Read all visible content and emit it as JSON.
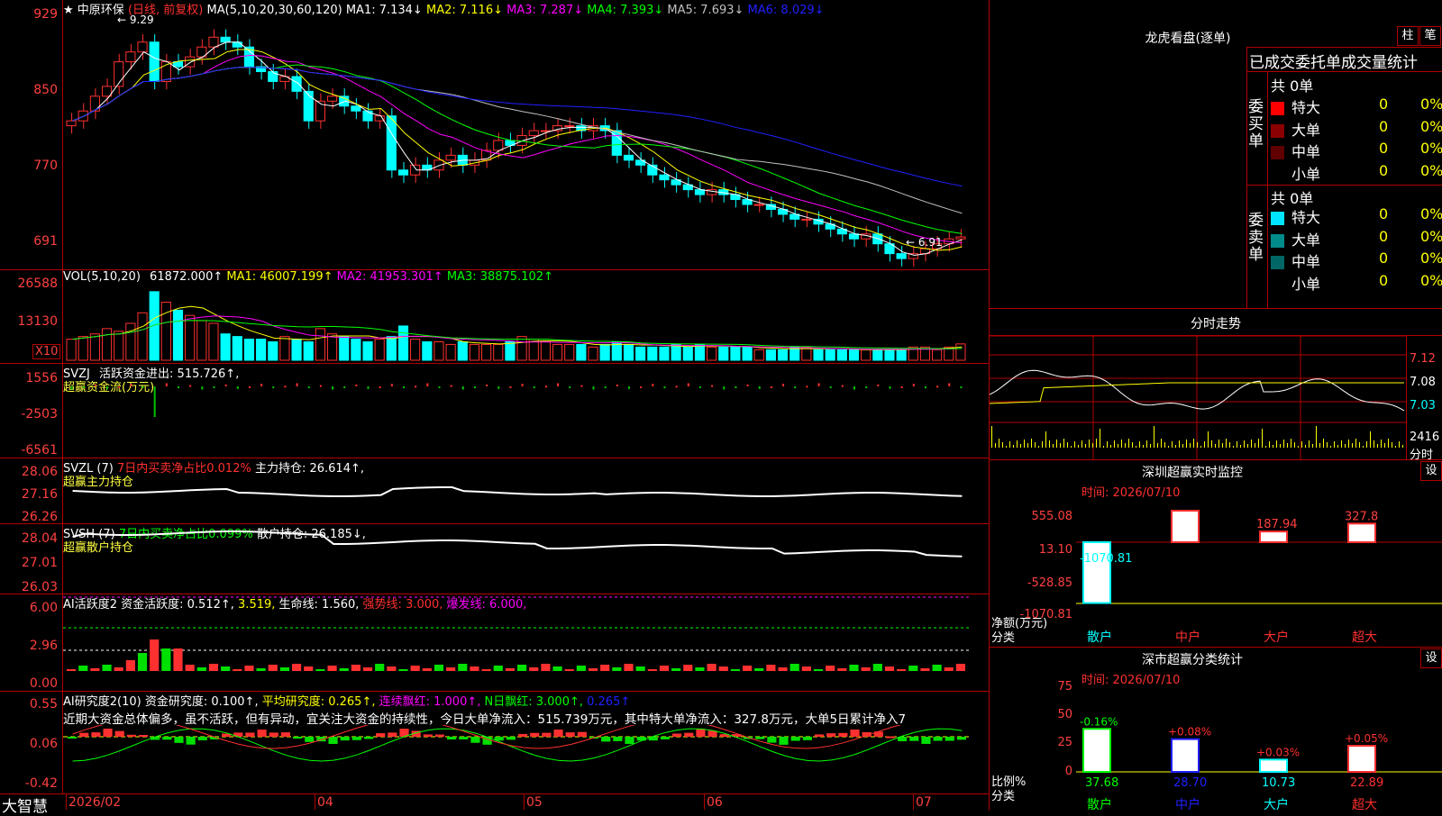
{
  "header": {
    "star": "★",
    "stock_name": "中原环保",
    "period": "(日线, 前复权)",
    "ma_params": "MA(5,10,20,30,60,120)",
    "ma": [
      {
        "label": "MA1: 7.134↓",
        "color": "#ffffff"
      },
      {
        "label": "MA2: 7.116↓",
        "color": "#ffff00"
      },
      {
        "label": "MA3: 7.287↓",
        "color": "#ff00ff"
      },
      {
        "label": "MA4: 7.393↓",
        "color": "#00ff00"
      },
      {
        "label": "MA5: 7.693↓",
        "color": "#c0c0c0"
      },
      {
        "label": "MA6: 8.029↓",
        "color": "#2020ff"
      }
    ],
    "high_marker": "9.29",
    "low_marker": "6.91"
  },
  "price_axis": [
    "929",
    "850",
    "770",
    "691"
  ],
  "vol_axis": [
    "26588",
    "13130",
    "X10"
  ],
  "zj_axis": [
    "1556",
    "-2503",
    "-6561"
  ],
  "zl_axis": [
    "28.06",
    "27.16",
    "26.26"
  ],
  "sh_axis": [
    "28.04",
    "27.01",
    "26.03"
  ],
  "ai1_axis": [
    "6.00",
    "2.96",
    "0.00"
  ],
  "ai2_axis": [
    "0.55",
    "0.06",
    "-0.42"
  ],
  "vol": {
    "params": "VOL(5,10,20)",
    "value": "61872.000↑",
    "ma": [
      {
        "label": "MA1: 46007.199↑",
        "color": "#ffff00"
      },
      {
        "label": "MA2: 41953.301↑",
        "color": "#ff00ff"
      },
      {
        "label": "MA3: 38875.102↑",
        "color": "#00ff00"
      }
    ]
  },
  "svzj": {
    "name": "SVZJ",
    "label": "活跃资金进出: 515.726↑,",
    "sub": "超赢资金流(万元)"
  },
  "svzl": {
    "name": "SVZL (7)",
    "pct": "7日内买卖净占比0.012%",
    "label": "主力持仓: 26.614↑,",
    "sub": "超赢主力持仓"
  },
  "svsh": {
    "name": "SVSH (7)",
    "pct": "7日内买卖净占比0.099%",
    "label": "散户持仓: 26.185↓,",
    "sub": "超赢散户持仓"
  },
  "ai1": {
    "name": "AI活跃度2",
    "items": [
      {
        "t": "资金活跃度: 0.512↑,",
        "c": "#ffffff"
      },
      {
        "t": "3.519,",
        "c": "#ffff00"
      },
      {
        "t": "生命线: 1.560,",
        "c": "#ffffff"
      },
      {
        "t": "强势线: 3.000,",
        "c": "#ff3030"
      },
      {
        "t": "爆发线: 6.000,",
        "c": "#ff00ff"
      }
    ]
  },
  "ai2": {
    "name": "AI研究度2(10)",
    "items": [
      {
        "t": "资金研究度: 0.100↑,",
        "c": "#ffffff"
      },
      {
        "t": "平均研究度: 0.265↑,",
        "c": "#ffff00"
      },
      {
        "t": "连续飘红: 1.000↑,",
        "c": "#ff00ff"
      },
      {
        "t": "N日飘红: 3.000↑,",
        "c": "#00ff00"
      },
      {
        "t": "0.265↑",
        "c": "#2020ff"
      }
    ]
  },
  "commentary": "近期大资金总体偏多，虽不活跃，但有异动，宜关注大资金的持续性，今日大单净流入：515.739万元，其中特大单净流入：327.8万元，大单5日累计净入7",
  "x_axis": [
    {
      "t": "2026/02",
      "x": 76
    },
    {
      "t": "04",
      "x": 352
    },
    {
      "t": "05",
      "x": 584
    },
    {
      "t": "06",
      "x": 784
    },
    {
      "t": "07",
      "x": 1016
    }
  ],
  "footer_brand": "大智慧",
  "right": {
    "lhb_title": "龙虎看盘(逐单)",
    "btn_zhu": "柱",
    "btn_bi": "笔",
    "orders_title": "已成交委托单成交量统计",
    "buy": {
      "label": "委买单",
      "total": "共 0单",
      "rows": [
        {
          "name": "特大",
          "count": "0",
          "pct": "0%",
          "color": "#ff0000"
        },
        {
          "name": "大单",
          "count": "0",
          "pct": "0%",
          "color": "#8b0000"
        },
        {
          "name": "中单",
          "count": "0",
          "pct": "0%",
          "color": "#600000"
        },
        {
          "name": "小单",
          "count": "0",
          "pct": "0%",
          "color": ""
        }
      ]
    },
    "sell": {
      "label": "委卖单",
      "total": "共 0单",
      "rows": [
        {
          "name": "特大",
          "count": "0",
          "pct": "0%",
          "color": "#00e5ff"
        },
        {
          "name": "大单",
          "count": "0",
          "pct": "0%",
          "color": "#008b8b"
        },
        {
          "name": "中单",
          "count": "0",
          "pct": "0%",
          "color": "#006666"
        },
        {
          "name": "小单",
          "count": "0",
          "pct": "0%",
          "color": ""
        }
      ]
    },
    "intraday": {
      "title": "分时走势",
      "price_labels": [
        "7.12",
        "7.08",
        "7.03"
      ],
      "vol_label": "2416",
      "vol_unit": "分时"
    },
    "monitor": {
      "title": "深圳超赢实时监控",
      "btn": "设",
      "time": "时间: 2026/07/10",
      "axis": [
        "555.08",
        "13.10",
        "-528.85",
        "-1070.81"
      ],
      "unit_label": "净额(万元)",
      "cat_label": "分类",
      "bars": [
        {
          "cat": "散户",
          "value": -1070.81,
          "label": "-1070.81"
        },
        {
          "cat": "中户",
          "value": 555.08,
          "label": "555.08"
        },
        {
          "cat": "大户",
          "value": 187.94,
          "label": "187.94"
        },
        {
          "cat": "超大",
          "value": 327.8,
          "label": "327.8"
        }
      ]
    },
    "classify": {
      "title": "深市超赢分类统计",
      "btn": "设",
      "time": "时间: 2026/07/10",
      "axis": [
        "75",
        "50",
        "25",
        "0"
      ],
      "unit_label": "比例%",
      "cat_label": "分类",
      "bars": [
        {
          "cat": "散户",
          "value": 37.68,
          "label": "37.68",
          "change": "-0.16%"
        },
        {
          "cat": "中户",
          "value": 28.7,
          "label": "28.70",
          "change": "+0.08%"
        },
        {
          "cat": "大户",
          "value": 10.73,
          "label": "10.73",
          "change": "+0.03%"
        },
        {
          "cat": "超大",
          "value": 22.89,
          "label": "22.89",
          "change": "+0.05%"
        }
      ]
    }
  },
  "chart_data": [
    {
      "type": "candlestick",
      "title": "中原环保 (日线, 前复权)",
      "ylim": [
        6.91,
        9.29
      ],
      "categories": [
        "2026/02",
        "04",
        "05",
        "06",
        "07"
      ],
      "close_series": [
        8.3,
        8.4,
        8.55,
        8.65,
        8.9,
        9.0,
        9.1,
        8.7,
        8.9,
        8.85,
        8.95,
        9.05,
        9.15,
        9.1,
        9.05,
        8.85,
        8.8,
        8.7,
        8.75,
        8.6,
        8.3,
        8.5,
        8.55,
        8.45,
        8.4,
        8.3,
        8.35,
        7.8,
        7.75,
        7.85,
        7.8,
        7.9,
        7.95,
        7.85,
        7.9,
        8.0,
        8.1,
        8.05,
        8.15,
        8.2,
        8.2,
        8.25,
        8.25,
        8.2,
        8.25,
        8.2,
        7.95,
        7.9,
        7.85,
        7.75,
        7.7,
        7.65,
        7.6,
        7.55,
        7.6,
        7.55,
        7.5,
        7.45,
        7.45,
        7.4,
        7.35,
        7.3,
        7.3,
        7.25,
        7.2,
        7.15,
        7.1,
        7.15,
        7.05,
        6.95,
        6.9,
        6.95,
        7.0,
        7.05,
        7.1,
        7.12
      ]
    },
    {
      "type": "bar",
      "title": "VOL(5,10,20)",
      "values": [
        8,
        9,
        10,
        12,
        11,
        14,
        18,
        26,
        22,
        19,
        17,
        15,
        14,
        10,
        9,
        8,
        8,
        7,
        9,
        8,
        7,
        12,
        10,
        9,
        8,
        7,
        8,
        9,
        13,
        8,
        7,
        7,
        6,
        7,
        6,
        6,
        6,
        7,
        9,
        8,
        7,
        6,
        6,
        6,
        5,
        6,
        7,
        6,
        5,
        5,
        5,
        6,
        5,
        6,
        5,
        5,
        5,
        5,
        4,
        4,
        4,
        5,
        5,
        4,
        4,
        4,
        4,
        4,
        4,
        4,
        4,
        5,
        5,
        4,
        5,
        6.2
      ]
    }
  ]
}
